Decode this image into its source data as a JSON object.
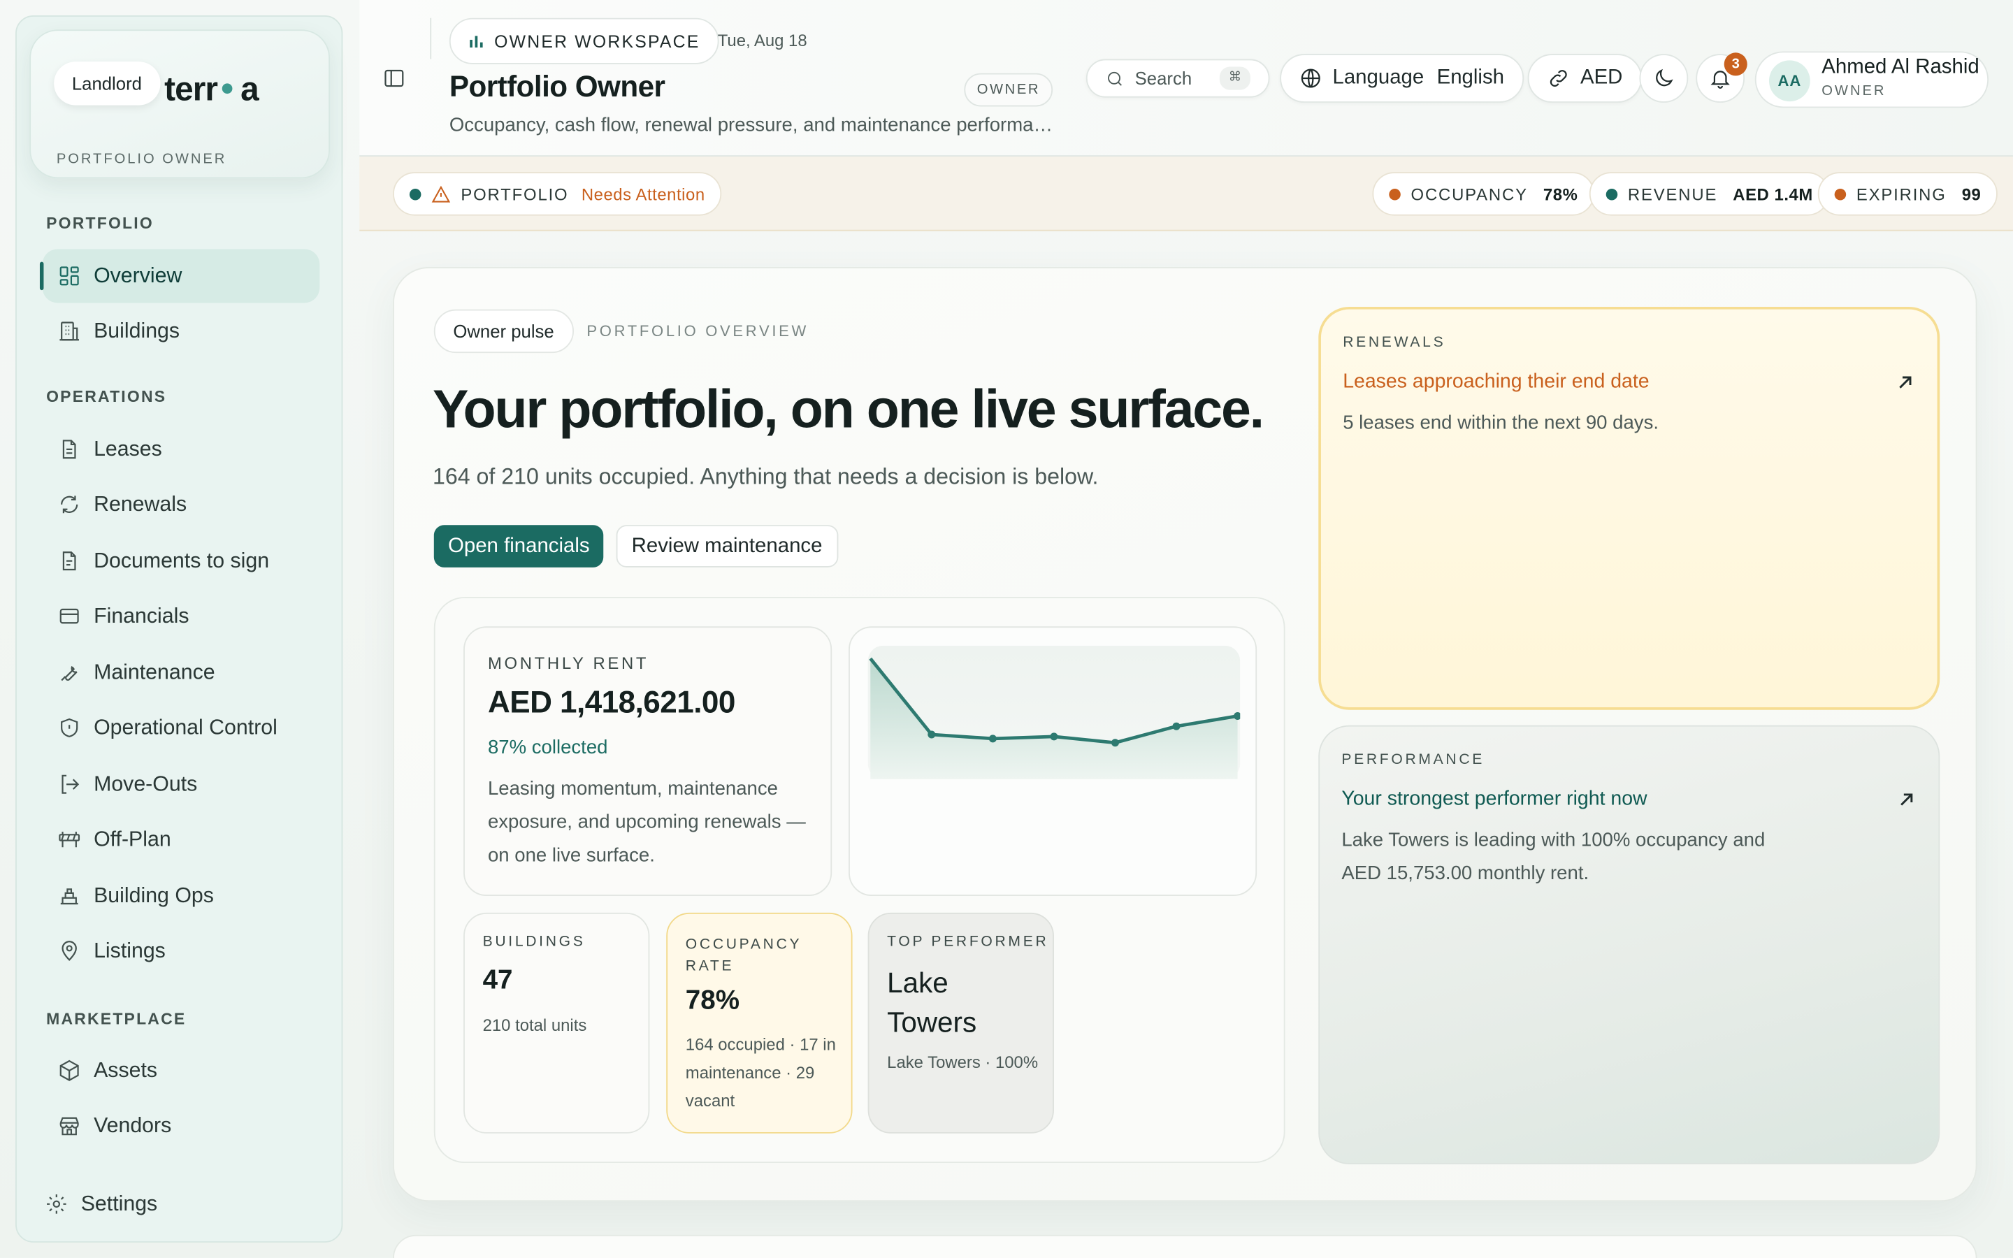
{
  "brand": {
    "pill": "Landlord",
    "logo_left": "terr",
    "logo_right": "a",
    "subtitle": "PORTFOLIO OWNER"
  },
  "sidebar": {
    "sections": [
      "PORTFOLIO",
      "OPERATIONS",
      "MARKETPLACE"
    ],
    "items": [
      {
        "label": "Overview",
        "icon": "grid-icon",
        "active": true
      },
      {
        "label": "Buildings",
        "icon": "building-icon"
      },
      {
        "label": "Leases",
        "icon": "document-icon"
      },
      {
        "label": "Renewals",
        "icon": "refresh-icon"
      },
      {
        "label": "Documents to sign",
        "icon": "document-sign-icon"
      },
      {
        "label": "Financials",
        "icon": "card-icon"
      },
      {
        "label": "Maintenance",
        "icon": "wrench-icon"
      },
      {
        "label": "Operational Control",
        "icon": "shield-icon"
      },
      {
        "label": "Move-Outs",
        "icon": "exit-icon"
      },
      {
        "label": "Off-Plan",
        "icon": "barrier-icon"
      },
      {
        "label": "Building Ops",
        "icon": "ops-icon"
      },
      {
        "label": "Listings",
        "icon": "pin-icon"
      },
      {
        "label": "Assets",
        "icon": "box-icon"
      },
      {
        "label": "Vendors",
        "icon": "store-icon"
      }
    ],
    "settings": "Settings"
  },
  "header": {
    "workspace": "OWNER WORKSPACE",
    "date": "Tue, Aug 18",
    "title": "Portfolio Owner",
    "subtitle": "Occupancy, cash flow, renewal pressure, and maintenance performance",
    "role_tag": "OWNER",
    "search_placeholder": "Search",
    "search_kbd": "⌘",
    "language_label": "Language",
    "language_value": "English",
    "currency": "AED",
    "notifications": "3",
    "user": {
      "initials": "AA",
      "name": "Ahmed Al Rashid",
      "role": "OWNER"
    }
  },
  "strip": {
    "portfolio_label": "PORTFOLIO",
    "portfolio_status": "Needs Attention",
    "metrics": [
      {
        "label": "OCCUPANCY",
        "value": "78%",
        "color": "#c9601d"
      },
      {
        "label": "REVENUE",
        "value": "AED 1.4M",
        "color": "#1b6b62"
      },
      {
        "label": "EXPIRING",
        "value": "99",
        "color": "#c9601d"
      }
    ]
  },
  "main": {
    "pulse": "Owner pulse",
    "overview_label": "PORTFOLIO OVERVIEW",
    "hero": "Your portfolio, on one live surface.",
    "hero_sub": "164 of 210 units occupied. Anything that needs a decision is below.",
    "primary_button": "Open financials",
    "secondary_button": "Review maintenance",
    "rent": {
      "label": "MONTHLY RENT",
      "value": "AED 1,418,621.00",
      "collected": "87% collected",
      "desc": "Leasing momentum, maintenance exposure, and upcoming renewals — on one live surface."
    },
    "stats": {
      "buildings": {
        "label": "BUILDINGS",
        "value": "47",
        "sub": "210 total units"
      },
      "occupancy": {
        "label": "OCCUPANCY RATE",
        "value": "78%",
        "sub": "164 occupied · 17 in maintenance · 29 vacant"
      },
      "top": {
        "label": "TOP PERFORMER",
        "value": "Lake Towers",
        "sub": "Lake Towers · 100%"
      }
    },
    "renewals": {
      "label": "RENEWALS",
      "title": "Leases approaching their end date",
      "desc": "5 leases end within the next 90 days."
    },
    "performance": {
      "label": "PERFORMANCE",
      "title": "Your strongest performer right now",
      "desc": "Lake Towers is leading with 100% occupancy and AED 15,753.00 monthly rent."
    }
  },
  "chart_data": {
    "type": "area",
    "series": [
      {
        "values": [
          1.0,
          0.26,
          0.22,
          0.24,
          0.18,
          0.34,
          0.44
        ]
      }
    ],
    "colors": {
      "line": "#2d7a70",
      "fill": "#cfe3dc"
    }
  }
}
